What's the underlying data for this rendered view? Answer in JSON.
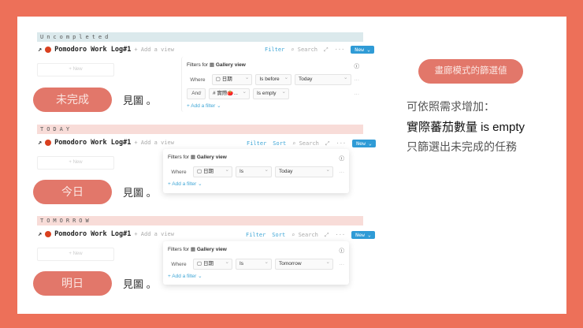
{
  "sections": [
    {
      "band": "Uncompleted",
      "title": "Pomodoro Work Log#1",
      "add_view": "+ Add a view",
      "tools": {
        "filter": "Filter",
        "search": "Search",
        "new": "New"
      },
      "new_card": "+ New",
      "pill": "未完成",
      "see": "見圖 。",
      "filter": {
        "header": "Filters for",
        "view": "Gallery view",
        "add": "Add a filter",
        "rows": [
          {
            "conj": "Where",
            "prop": "日期",
            "op": "Is before",
            "val": "Today"
          },
          {
            "conj": "And",
            "prop": "實際🍅...",
            "op": "Is empty",
            "val": ""
          }
        ]
      }
    },
    {
      "band": "TODAY",
      "title": "Pomodoro Work Log#1",
      "add_view": "+ Add a view",
      "tools": {
        "filter": "Filter",
        "sort": "Sort",
        "search": "Search",
        "new": "New"
      },
      "new_card": "+ New",
      "pill": "今日",
      "see": "見圖 。",
      "filter": {
        "header": "Filters for",
        "view": "Gallery view",
        "add": "Add a filter",
        "rows": [
          {
            "conj": "Where",
            "prop": "日期",
            "op": "Is",
            "val": "Today"
          }
        ]
      }
    },
    {
      "band": "TOMORROW",
      "title": "Pomodoro Work Log#1",
      "add_view": "+ Add a view",
      "tools": {
        "filter": "Filter",
        "sort": "Sort",
        "search": "Search",
        "new": "New"
      },
      "new_card": "+ New",
      "pill": "明日",
      "see": "見圖 。",
      "filter": {
        "header": "Filters for",
        "view": "Gallery view",
        "add": "Add a filter",
        "rows": [
          {
            "conj": "Where",
            "prop": "日期",
            "op": "Is",
            "val": "Tomorrow"
          }
        ]
      }
    }
  ],
  "side": {
    "pill": "畫廊模式的篩選値",
    "line1": "可依照需求增加：",
    "line2": "實際蕃茄數量 is empty",
    "line3": "只篩選出未完成的任務"
  },
  "colors": {
    "bg": "#ed7059",
    "pill": "#e2776a",
    "band_blue": "#dbe9ec",
    "band_pink": "#f8dcd8",
    "accent": "#2f9bd6"
  }
}
